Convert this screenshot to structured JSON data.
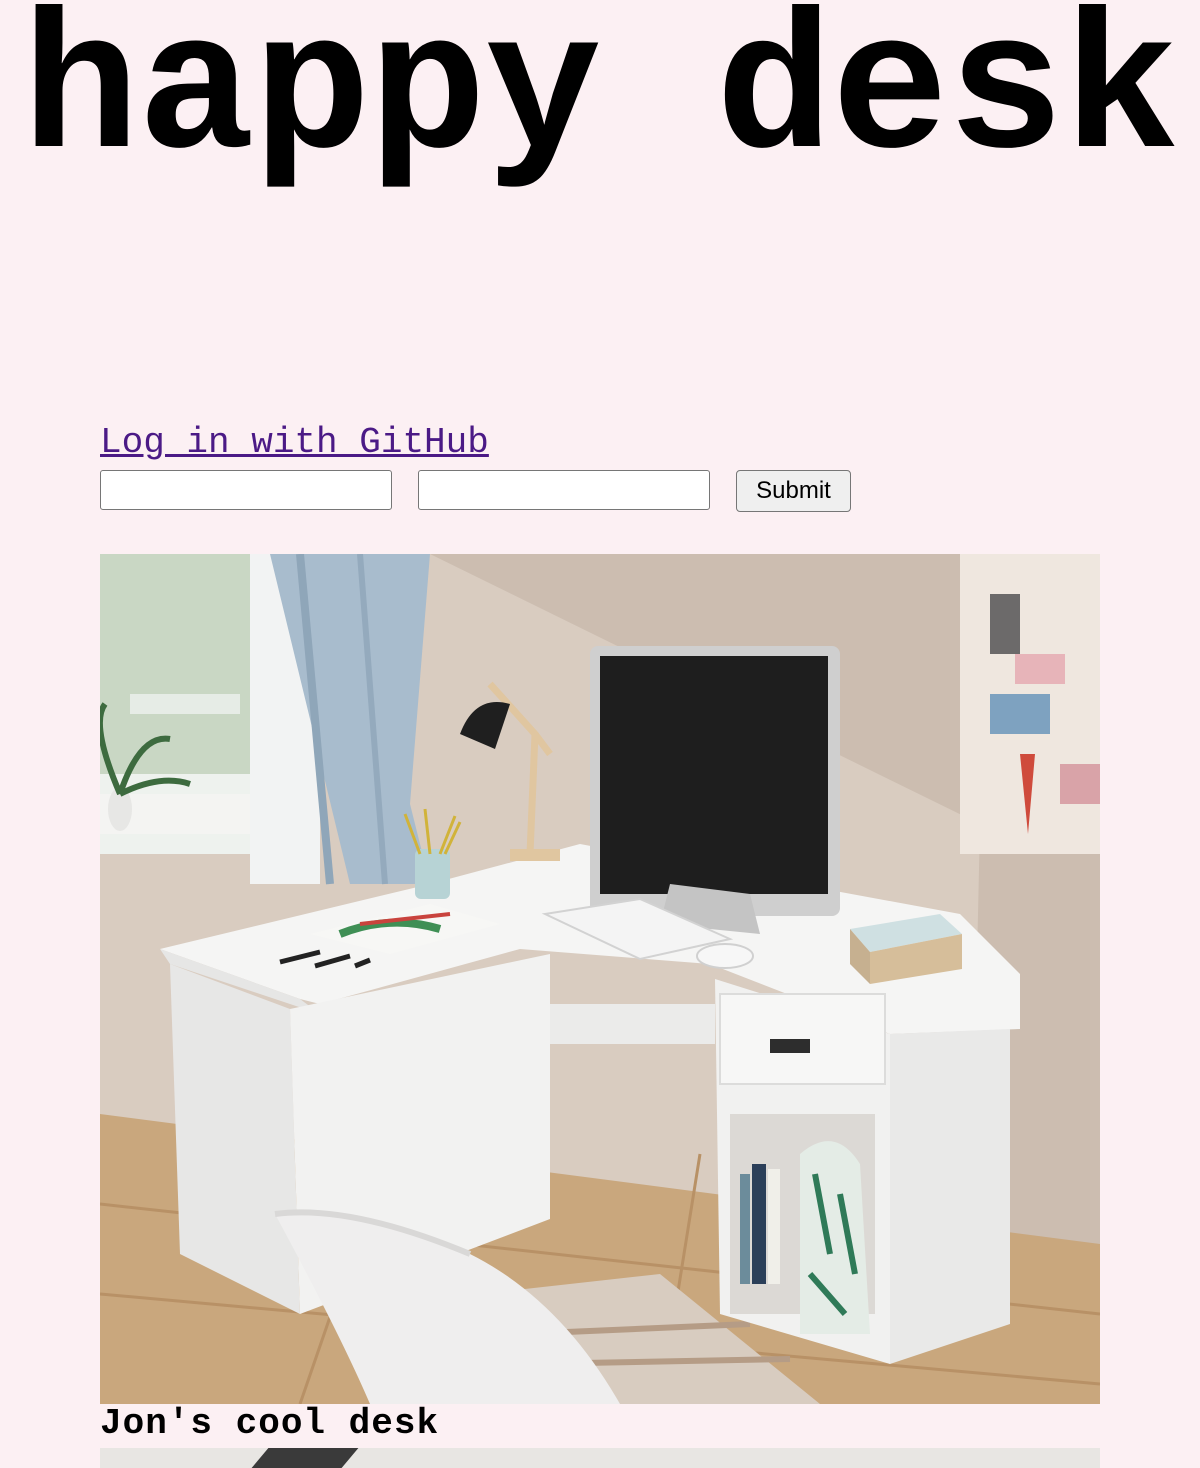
{
  "header": {
    "title": "happy desk"
  },
  "auth": {
    "login_link": "Log in with GitHub",
    "field_one_value": "",
    "field_two_value": "",
    "submit_label": "Submit"
  },
  "posts": [
    {
      "caption": "Jon's cool desk",
      "photo": "white corner desk with computer monitor, keyboard, lamp, chair and bookshelf"
    }
  ],
  "colors": {
    "background": "#fcf0f3",
    "link": "#4b1a86"
  }
}
